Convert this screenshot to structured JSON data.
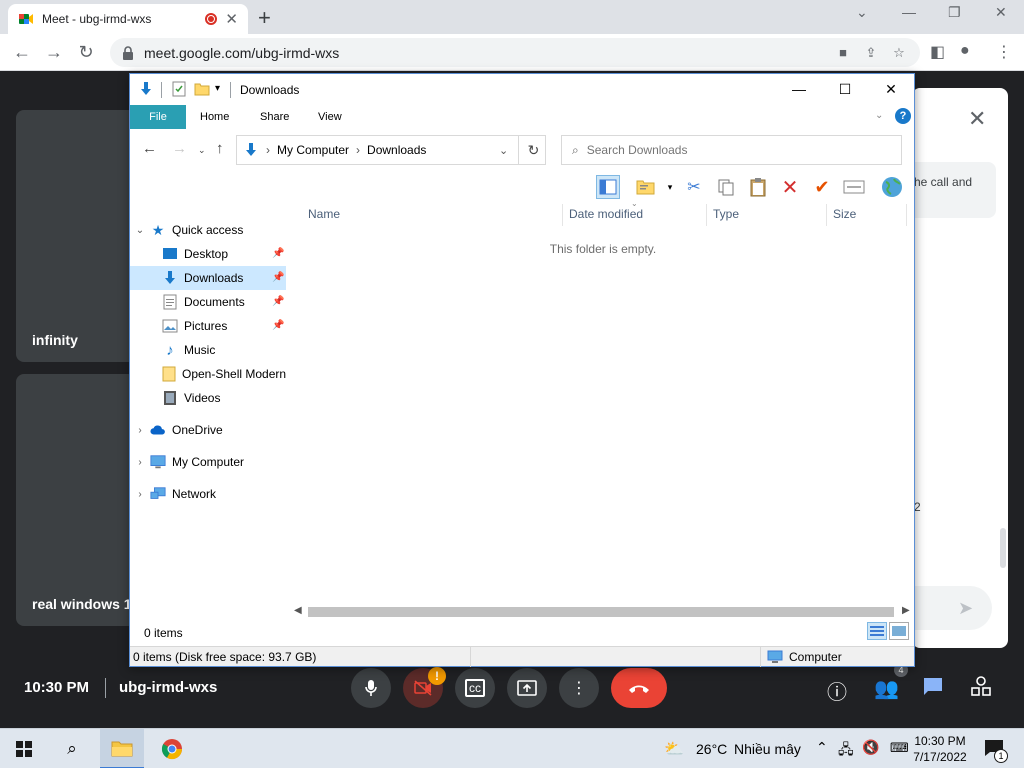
{
  "browser": {
    "tab_title": "Meet - ubg-irmd-wxs",
    "url": "meet.google.com/ubg-irmd-wxs"
  },
  "meet": {
    "tile1_name": "infinity",
    "tile2_name": "real windows 1",
    "side_text": "he call and",
    "side_num": "2",
    "clock": "10:30 PM",
    "code": "ubg-irmd-wxs",
    "warning_badge": "!",
    "people_count": "4"
  },
  "explorer": {
    "title": "Downloads",
    "ribbon_tabs": [
      "File",
      "Home",
      "Share",
      "View"
    ],
    "help": "?",
    "breadcrumb": [
      "My Computer",
      "Downloads"
    ],
    "search_placeholder": "Search Downloads",
    "nav": {
      "quick_access": "Quick access",
      "items": [
        {
          "label": "Desktop",
          "icon": "desktop-icon"
        },
        {
          "label": "Downloads",
          "icon": "downloads-icon"
        },
        {
          "label": "Documents",
          "icon": "documents-icon"
        },
        {
          "label": "Pictures",
          "icon": "pictures-icon"
        },
        {
          "label": "Music",
          "icon": "music-icon"
        },
        {
          "label": "Open-Shell Modern",
          "icon": "folder-icon"
        },
        {
          "label": "Videos",
          "icon": "videos-icon"
        }
      ],
      "onedrive": "OneDrive",
      "my_computer": "My Computer",
      "network": "Network"
    },
    "columns": [
      "Name",
      "Date modified",
      "Type",
      "Size"
    ],
    "empty_message": "This folder is empty.",
    "item_count": "0 items",
    "status_detail": "0 items (Disk free space: 93.7 GB)",
    "status_location": "Computer"
  },
  "taskbar": {
    "weather_temp": "26°C",
    "weather_text": "Nhiều mây",
    "time": "10:30 PM",
    "date": "7/17/2022",
    "notification_count": "1"
  },
  "colors": {
    "file_tab": "#2a9fb3",
    "selection": "#cce8ff",
    "meet_bg": "#202124",
    "end_call": "#ea4335"
  }
}
